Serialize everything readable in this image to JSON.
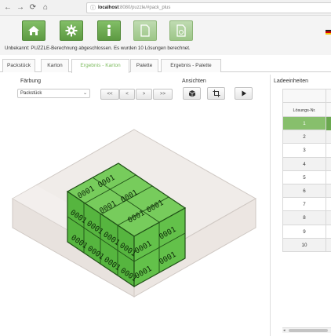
{
  "browser": {
    "nav": [
      "←",
      "→",
      "⟳",
      "⌂"
    ],
    "url_host": "localhost",
    "url_rest": ":8080/puzzle/#pack_plus"
  },
  "toolbar": {
    "buttons": [
      "home-icon",
      "gear-icon",
      "info-icon",
      "document-icon",
      "export-icon"
    ],
    "status": "Unbekannt:  PUZZLE-Berechnung abgeschlossen. Es wurden 10 Lösungen berechnet."
  },
  "tabs": [
    "Packstück",
    "Karton",
    "Ergebnis - Karton",
    "Palette",
    "Ergebnis - Palette"
  ],
  "active_tab": "Ergebnis - Karton",
  "left": {
    "faerbung_label": "Färbung",
    "faerbung_value": "Packstück",
    "pager": [
      "<<",
      "<",
      ">",
      ">>"
    ],
    "ansichten_label": "Ansichten",
    "view_icons": [
      "cube-icon",
      "crop-icon",
      "play-icon"
    ],
    "box_label": "0001"
  },
  "right": {
    "title": "Ladeeinheiten",
    "column": "Lösungs-Nr.",
    "rows": [
      "1",
      "2",
      "3",
      "4",
      "5",
      "6",
      "7",
      "8",
      "9",
      "10"
    ],
    "selected": "1"
  },
  "colors": {
    "accent": "#6aa84f",
    "tab_active": "#7dbb5f",
    "box_fill": "#5fbe4a"
  }
}
